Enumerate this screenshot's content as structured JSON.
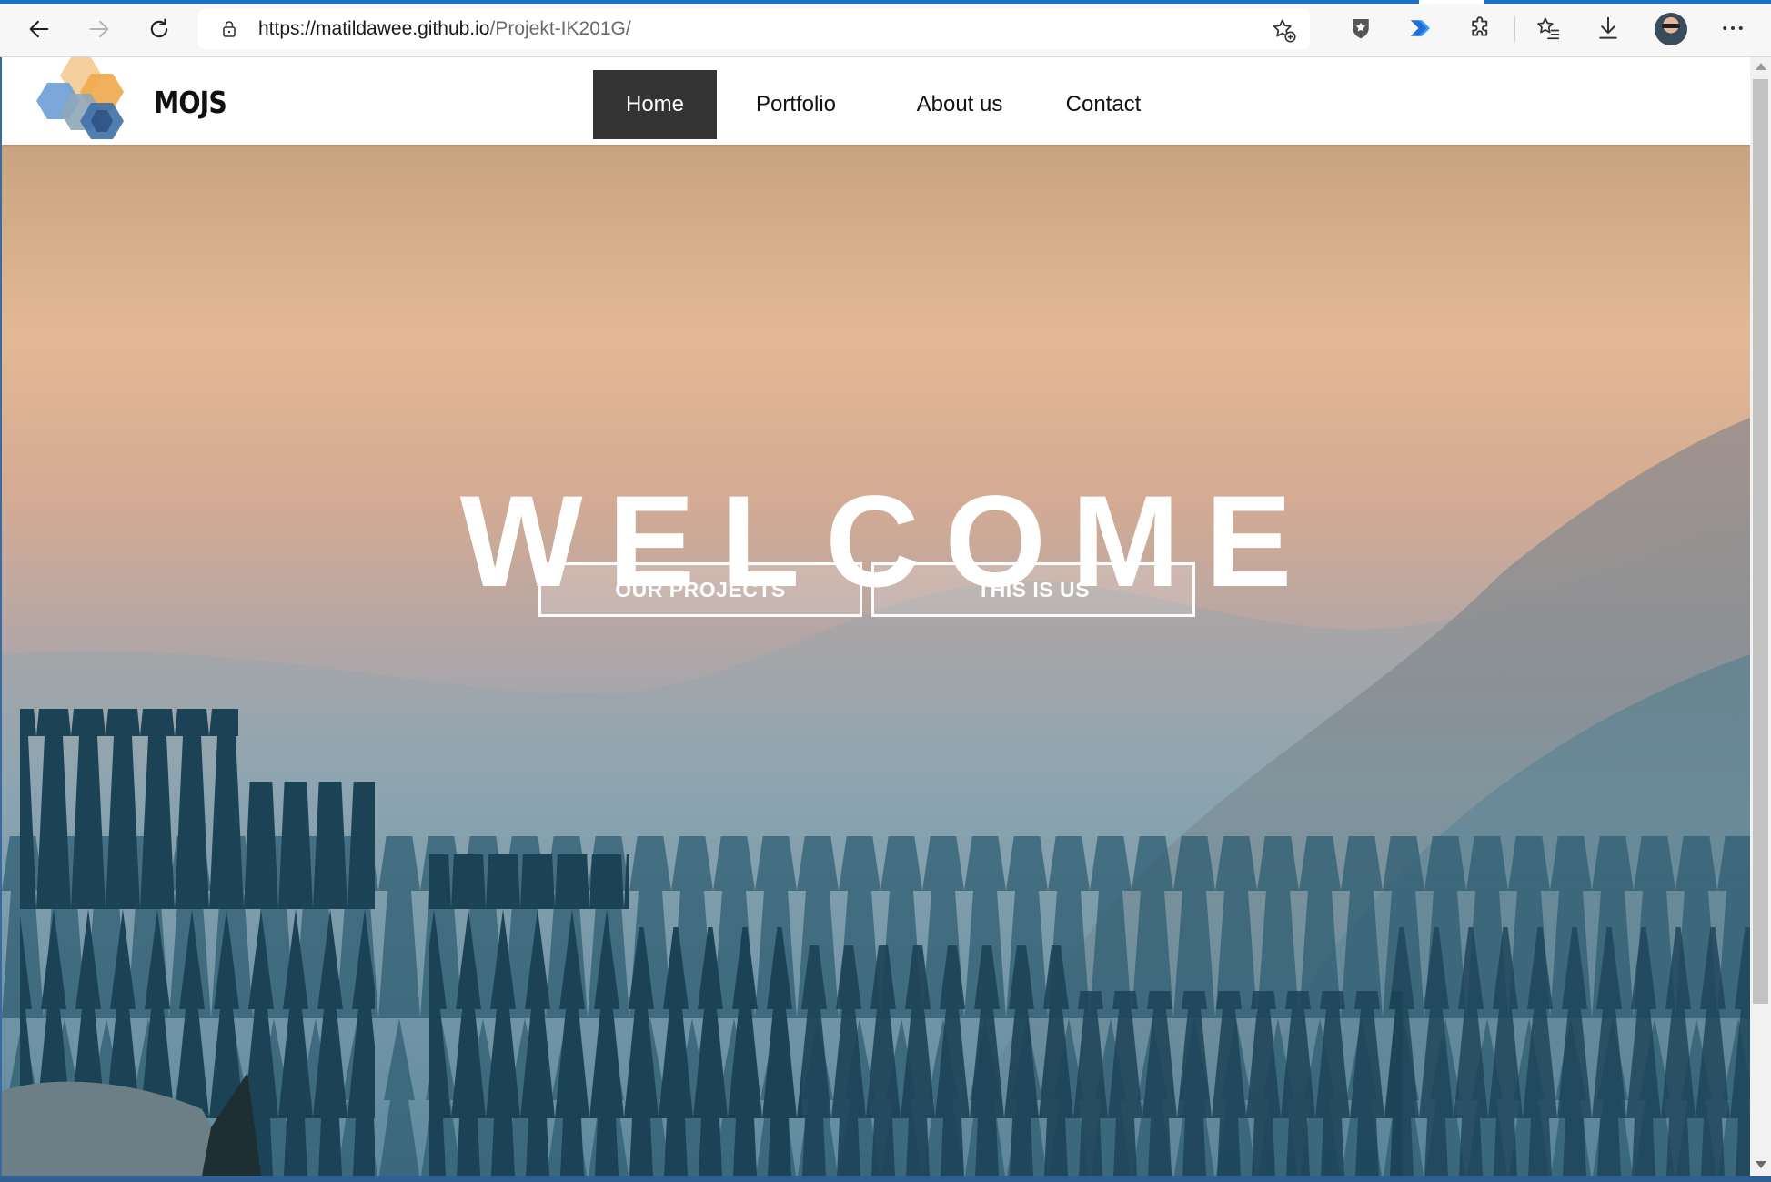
{
  "browser": {
    "url_host": "https://matildawee.github.io",
    "url_path": "/Projekt-IK201G/",
    "accent_color": "#1a73c9"
  },
  "icons": {
    "back": "back-arrow-icon",
    "forward": "forward-arrow-icon",
    "refresh": "refresh-icon",
    "lock": "lock-icon",
    "favorite_add": "star-add-icon",
    "shield": "shield-icon",
    "extension_blue": "arrow-extension-icon",
    "extensions": "puzzle-icon",
    "favorites": "favorites-icon",
    "downloads": "download-icon",
    "more": "more-icon"
  },
  "site": {
    "logo_text": "MOJS",
    "nav": [
      "Home",
      "Portfolio",
      "About us",
      "Contact"
    ],
    "active_nav": "Home",
    "hero": {
      "title": "WELCOME",
      "button_projects": "OUR PROJECTS",
      "button_us": "THIS IS US"
    }
  }
}
